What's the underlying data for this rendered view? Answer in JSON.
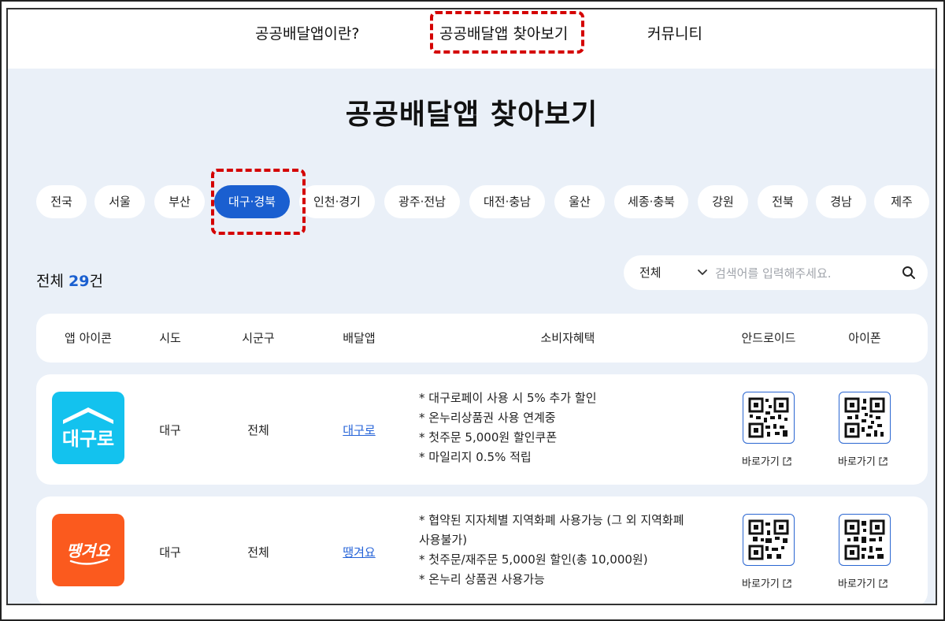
{
  "nav": {
    "items": [
      "공공배달앱이란?",
      "공공배달앱 찾아보기",
      "커뮤니티"
    ]
  },
  "page_title": "공공배달앱 찾아보기",
  "regions": [
    "전국",
    "서울",
    "부산",
    "대구·경북",
    "인천·경기",
    "광주·전남",
    "대전·충남",
    "울산",
    "세종·충북",
    "강원",
    "전북",
    "경남",
    "제주"
  ],
  "active_region": "대구·경북",
  "summary": {
    "prefix": "전체 ",
    "count": "29",
    "suffix": "건"
  },
  "search": {
    "select_value": "전체",
    "placeholder": "검색어를 입력해주세요."
  },
  "table": {
    "headers": [
      "앱 아이콘",
      "시도",
      "시군구",
      "배달앱",
      "소비자혜택",
      "안드로이드",
      "아이폰"
    ],
    "rows": [
      {
        "icon_name": "daeguro-app-icon",
        "icon_text": "대구로",
        "icon_color": "#13c2ee",
        "sido": "대구",
        "sigungu": "전체",
        "app": "대구로",
        "benefits": [
          "* 대구로페이 사용 시 5% 추가 할인",
          "* 온누리상품권 사용 연계중",
          "* 첫주문 5,000원 할인쿠폰",
          "* 마일리지 0.5% 적립"
        ],
        "android_link": "바로가기",
        "ios_link": "바로가기"
      },
      {
        "icon_name": "ddaenggyeoyo-app-icon",
        "icon_text": "땡겨요",
        "icon_color": "#fb5a1e",
        "sido": "대구",
        "sigungu": "전체",
        "app": "땡겨요",
        "benefits": [
          "* 협약된 지자체별 지역화폐 사용가능 (그 외 지역화폐",
          "사용불가)",
          "* 첫주문/재주문 5,000원 할인(총 10,000원)",
          "* 온누리 상품권 사용가능"
        ],
        "android_link": "바로가기",
        "ios_link": "바로가기"
      }
    ]
  },
  "colors": {
    "accent": "#1a5fd0",
    "page_bg": "#eaf0f8",
    "highlight": "#d40000"
  }
}
